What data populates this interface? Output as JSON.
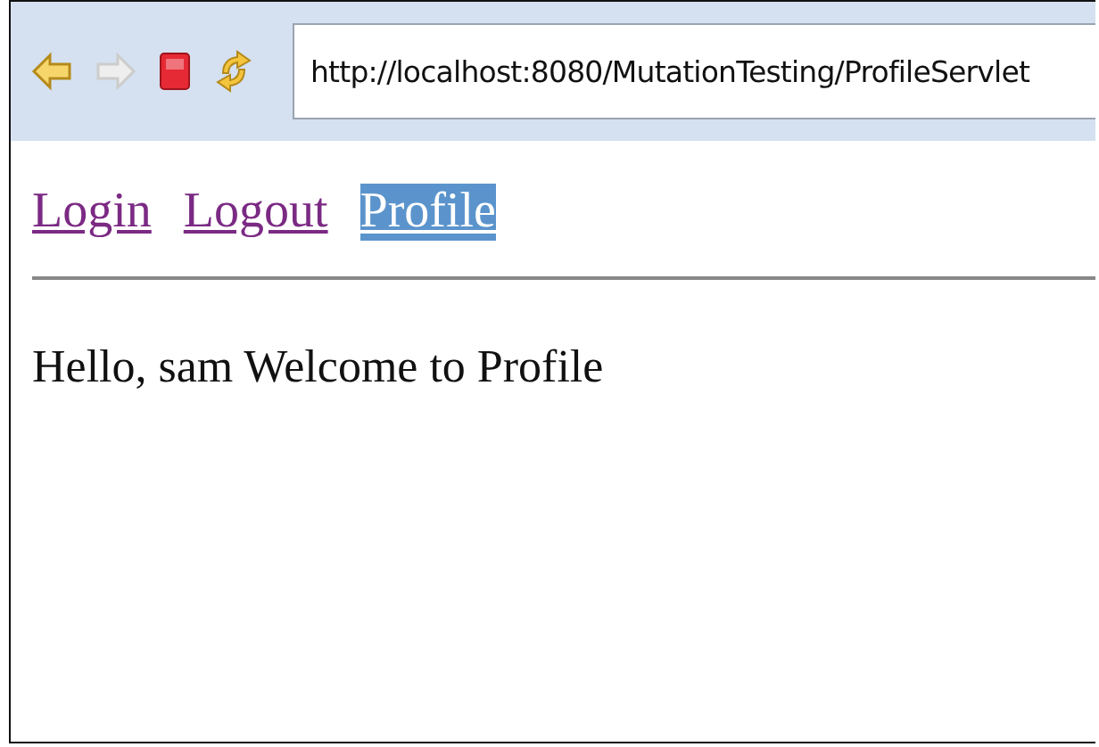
{
  "toolbar": {
    "buttons": [
      {
        "kind": "back",
        "disabled": false
      },
      {
        "kind": "forward",
        "disabled": true
      },
      {
        "kind": "stop",
        "disabled": false
      },
      {
        "kind": "refresh",
        "disabled": false
      }
    ],
    "address": "http://localhost:8080/MutationTesting/ProfileServlet"
  },
  "nav_links": [
    {
      "label": "Login",
      "selected": false
    },
    {
      "label": "Logout",
      "selected": false
    },
    {
      "label": "Profile",
      "selected": true
    }
  ],
  "message": "Hello, sam Welcome to Profile"
}
